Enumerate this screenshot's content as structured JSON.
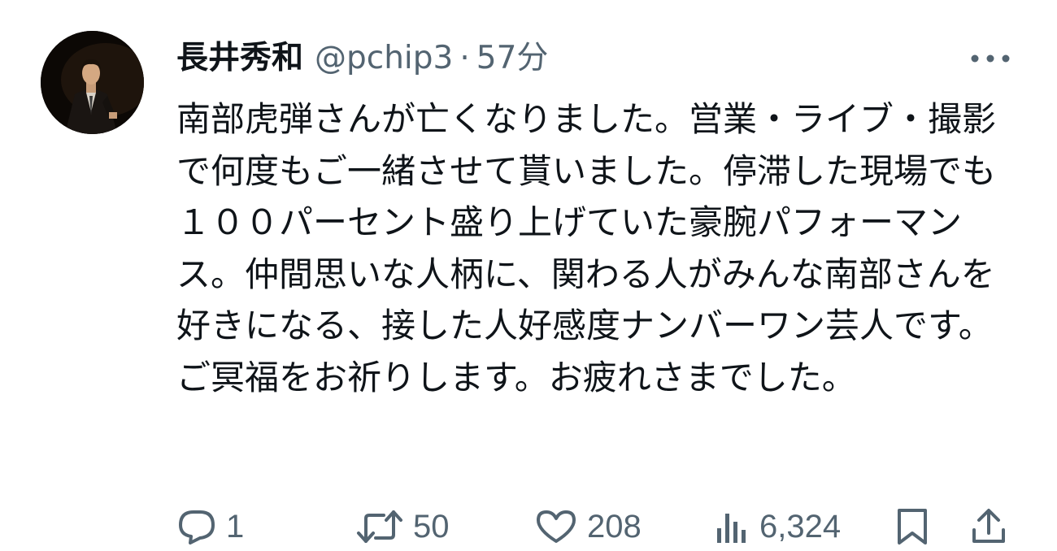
{
  "author": {
    "display_name": "長井秀和",
    "handle": "@pchip3",
    "separator": "·",
    "time_ago": "57分"
  },
  "tweet": {
    "text": "南部虎弾さんが亡くなりました。営業・ライブ・撮影で何度もご一緒させて貰いました。停滞した現場でも１００パーセント盛り上げていた豪腕パフォーマンス。仲間思いな人柄に、関わる人がみんな南部さんを好きになる、接した人好感度ナンバーワン芸人です。ご冥福をお祈りします。お疲れさまでした。"
  },
  "actions": {
    "reply": {
      "icon": "reply-icon",
      "count": "1"
    },
    "retweet": {
      "icon": "retweet-icon",
      "count": "50"
    },
    "like": {
      "icon": "heart-icon",
      "count": "208"
    },
    "views": {
      "icon": "views-icon",
      "count": "6,324"
    },
    "bookmark": {
      "icon": "bookmark-icon"
    },
    "share": {
      "icon": "share-icon"
    }
  },
  "more": {
    "icon": "more-icon"
  },
  "colors": {
    "text_primary": "#0f1419",
    "text_secondary": "#536471",
    "background": "#ffffff"
  }
}
